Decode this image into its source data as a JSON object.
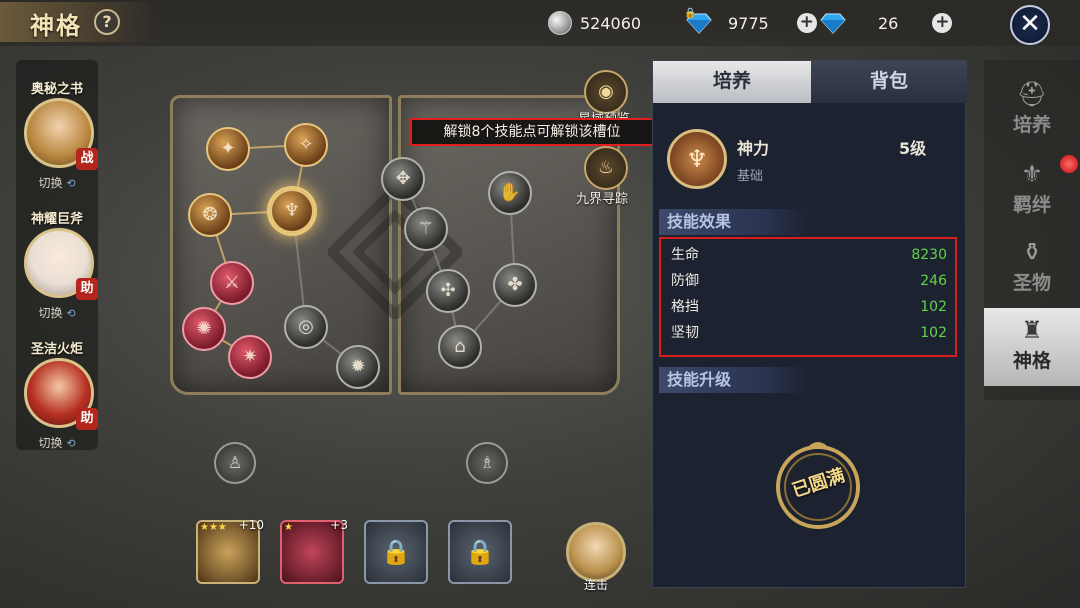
{
  "header": {
    "title": "神格",
    "help_icon": "?",
    "silver": "524060",
    "locked_diamonds": "9775",
    "diamonds": "26",
    "close_icon": "✕"
  },
  "characters": [
    {
      "name": "奥秘之书",
      "role": "战",
      "switch": "切换",
      "role_color": "#c8312b"
    },
    {
      "name": "神耀巨斧",
      "role": "助",
      "switch": "切换",
      "role_color": "#c8312b"
    },
    {
      "name": "圣洁火炬",
      "role": "助",
      "switch": "切换",
      "role_color": "#c8312b"
    }
  ],
  "tooltip": "解锁8个技能点可解锁该槽位",
  "side_buttons": [
    {
      "label": "星域预览",
      "icon": "eye-icon"
    },
    {
      "label": "九界寻踪",
      "icon": "flame-icon"
    }
  ],
  "slots": [
    {
      "level": "+10",
      "stars": "★★★",
      "type": "gold"
    },
    {
      "level": "+3",
      "stars": "★",
      "type": "red"
    },
    {
      "level": "",
      "stars": "",
      "type": "locked"
    },
    {
      "level": "",
      "stars": "",
      "type": "locked"
    }
  ],
  "combo_label": "连击",
  "panel": {
    "tabs": [
      "培养",
      "背包"
    ],
    "skill_name": "神力",
    "skill_level": "5级",
    "skill_sub": "基础",
    "effects_title": "技能效果",
    "stats": [
      {
        "key": "生命",
        "value": "8230"
      },
      {
        "key": "防御",
        "value": "246"
      },
      {
        "key": "格挡",
        "value": "102"
      },
      {
        "key": "坚韧",
        "value": "102"
      }
    ],
    "upgrade_title": "技能升级",
    "maxed_text": "已圆满"
  },
  "nav": [
    {
      "label": "培养",
      "icon": "helmet-icon",
      "active": false
    },
    {
      "label": "羁绊",
      "icon": "bond-icon",
      "active": false
    },
    {
      "label": "圣物",
      "icon": "relic-icon",
      "active": false
    },
    {
      "label": "神格",
      "icon": "divinity-icon",
      "active": true
    }
  ],
  "colors": {
    "accent_gold": "#d9c38a",
    "stat_green": "#62d44a",
    "highlight_red": "#e01f1f"
  }
}
